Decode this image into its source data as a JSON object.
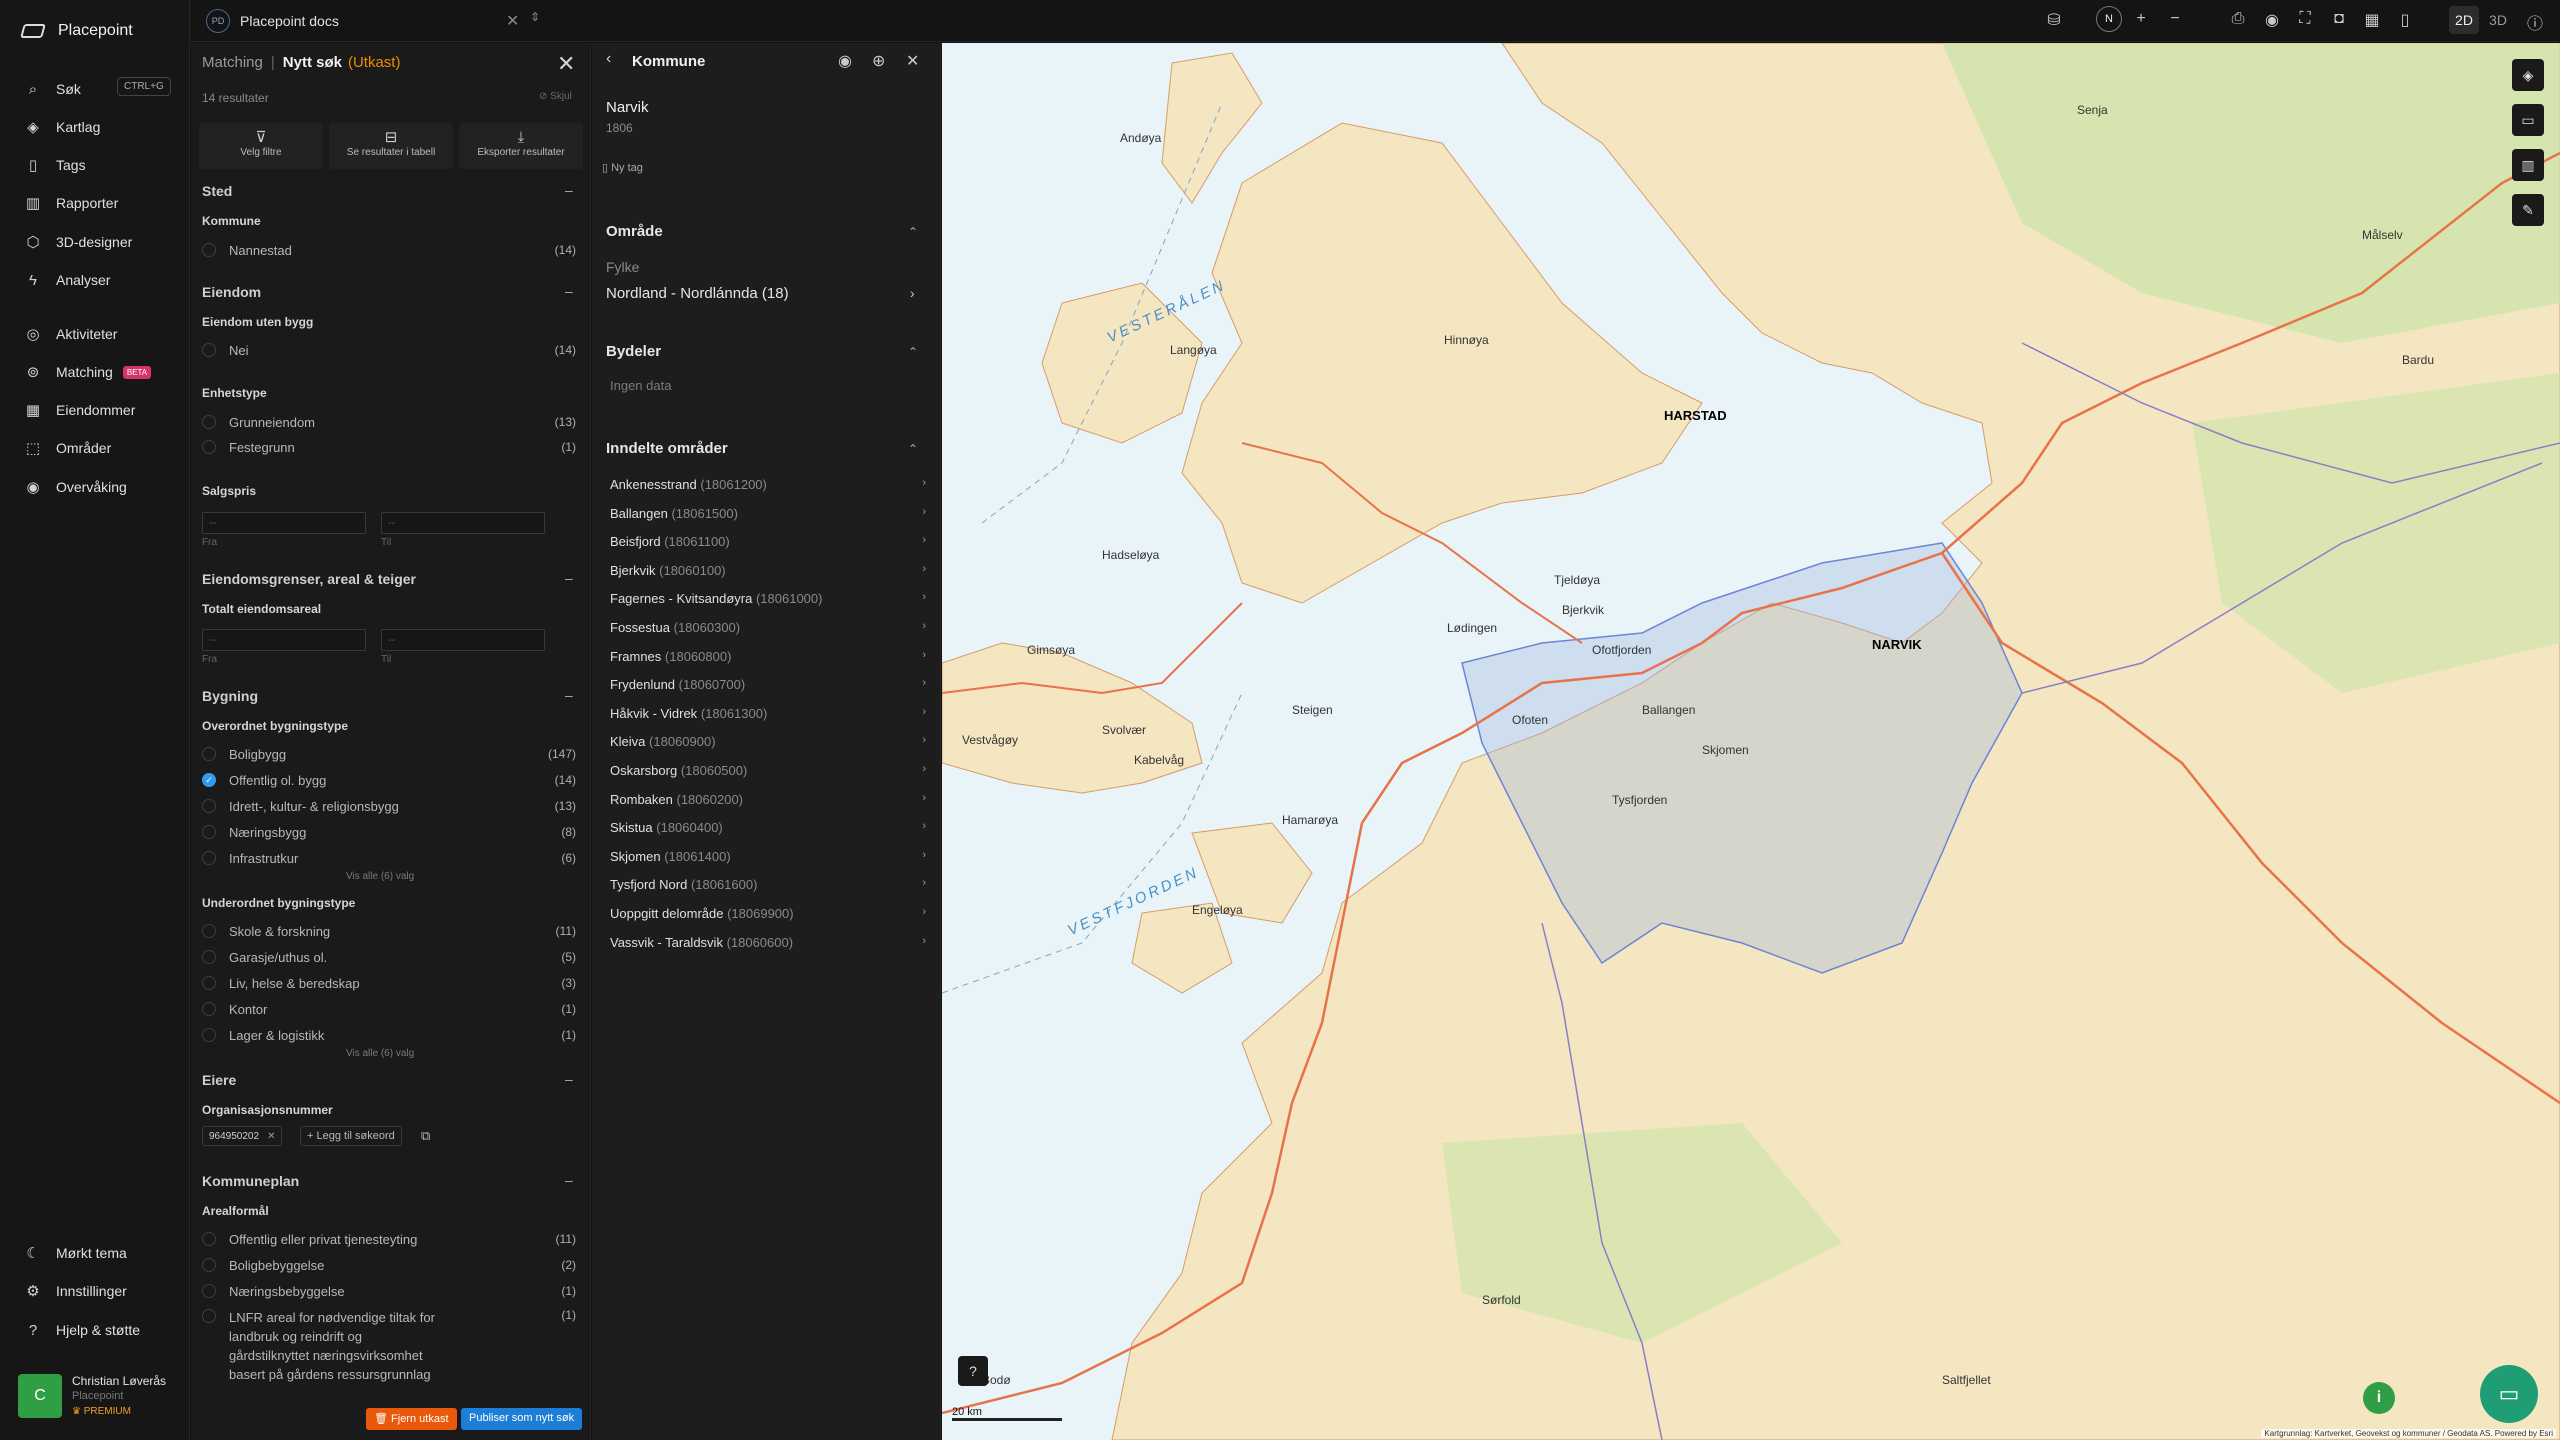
{
  "app": {
    "brand": "Placepoint"
  },
  "topbar": {
    "doc_badge": "PD",
    "doc_title": "Placepoint docs",
    "north": "N",
    "mode_2d": "2D",
    "mode_3d": "3D"
  },
  "nav": {
    "shortcut": "CTRL+G",
    "beta": "BETA",
    "items": [
      {
        "label": "Søk",
        "icon": "search-icon"
      },
      {
        "label": "Kartlag",
        "icon": "layers-icon"
      },
      {
        "label": "Tags",
        "icon": "bookmark-icon"
      },
      {
        "label": "Rapporter",
        "icon": "chart-icon"
      },
      {
        "label": "3D-designer",
        "icon": "cube-icon"
      },
      {
        "label": "Analyser",
        "icon": "bolt-icon"
      },
      {
        "label": "Aktiviteter",
        "icon": "activity-icon"
      },
      {
        "label": "Matching",
        "icon": "matching-icon"
      },
      {
        "label": "Eiendommer",
        "icon": "grid-icon"
      },
      {
        "label": "Områder",
        "icon": "area-icon"
      },
      {
        "label": "Overvåking",
        "icon": "monitor-icon"
      }
    ],
    "bottom": [
      {
        "label": "Mørkt tema",
        "icon": "moon-icon"
      },
      {
        "label": "Innstillinger",
        "icon": "gear-icon"
      },
      {
        "label": "Hjelp & støtte",
        "icon": "help-icon"
      }
    ],
    "user": {
      "initial": "C",
      "name": "Christian Løverås",
      "org": "Placepoint",
      "plan": "PREMIUM"
    }
  },
  "search": {
    "header_left": "Matching",
    "header_title": "Nytt søk",
    "header_status": "(Utkast)",
    "result_count": "14 resultater",
    "hide": "Skjul",
    "actions": [
      "Velg filtre",
      "Se resultater i tabell",
      "Eksporter resultater"
    ],
    "sections": {
      "sted": "Sted",
      "eiendom": "Eiendom",
      "grenser": "Eiendomsgrenser, areal & teiger",
      "bygning": "Bygning",
      "eiere": "Eiere",
      "kommuneplan": "Kommuneplan"
    },
    "kommune_label": "Kommune",
    "kommune_opts": [
      {
        "label": "Nannestad",
        "count": "(14)"
      }
    ],
    "uten_bygg_label": "Eiendom uten bygg",
    "uten_bygg_opts": [
      {
        "label": "Nei",
        "count": "(14)"
      }
    ],
    "enhetstype_label": "Enhetstype",
    "enhetstype_opts": [
      {
        "label": "Grunneiendom",
        "count": "(13)"
      },
      {
        "label": "Festegrunn",
        "count": "(1)"
      }
    ],
    "salgspris_label": "Salgspris",
    "areal_label": "Totalt eiendomsareal",
    "range_placeholder": "--",
    "range_from": "Fra",
    "range_to": "Til",
    "overordnet_label": "Overordnet bygningstype",
    "overordnet_opts": [
      {
        "label": "Boligbygg",
        "count": "(147)",
        "checked": false
      },
      {
        "label": "Offentlig ol. bygg",
        "count": "(14)",
        "checked": true
      },
      {
        "label": "Idrett-, kultur- & religionsbygg",
        "count": "(13)",
        "checked": false
      },
      {
        "label": "Næringsbygg",
        "count": "(8)",
        "checked": false
      },
      {
        "label": "Infrastrutkur",
        "count": "(6)",
        "checked": false
      }
    ],
    "show_all_1": "Vis alle (6) valg",
    "underordnet_label": "Underordnet bygningstype",
    "underordnet_opts": [
      {
        "label": "Skole & forskning",
        "count": "(11)"
      },
      {
        "label": "Garasje/uthus ol.",
        "count": "(5)"
      },
      {
        "label": "Liv, helse & beredskap",
        "count": "(3)"
      },
      {
        "label": "Kontor",
        "count": "(1)"
      },
      {
        "label": "Lager & logistikk",
        "count": "(1)"
      }
    ],
    "show_all_2": "Vis alle (6) valg",
    "org_label": "Organisasjonsnummer",
    "org_chip": "964950202",
    "add_keyword": "Legg til søkeord",
    "arealformal_label": "Arealformål",
    "arealformal_opts": [
      {
        "label": "Offentlig eller privat tjenesteyting",
        "count": "(11)"
      },
      {
        "label": "Boligbebyggelse",
        "count": "(2)"
      },
      {
        "label": "Næringsbebyggelse",
        "count": "(1)"
      }
    ],
    "lnfr": {
      "line1": "LNFR areal for nødvendige tiltak for",
      "line2": "landbruk og reindrift og",
      "line3": "gårdstilknyttet næringsvirksomhet",
      "line4": "basert på gårdens ressursgrunnlag",
      "count": "(1)"
    },
    "btn_remove": "Fjern utkast",
    "btn_publish": "Publiser som nytt søk"
  },
  "kommune": {
    "title": "Kommune",
    "name": "Narvik",
    "code": "1806",
    "tag": "Ny tag",
    "omrade": "Område",
    "fylke_label": "Fylke",
    "fylke_value": "Nordland - Nordlánnda (18)",
    "bydeler": "Bydeler",
    "bydeler_empty": "Ingen data",
    "inndelte": "Inndelte områder",
    "areas": [
      {
        "name": "Ankenesstrand",
        "code": "(18061200)"
      },
      {
        "name": "Ballangen",
        "code": "(18061500)"
      },
      {
        "name": "Beisfjord",
        "code": "(18061100)"
      },
      {
        "name": "Bjerkvik",
        "code": "(18060100)"
      },
      {
        "name": "Fagernes - Kvitsandøyra",
        "code": "(18061000)"
      },
      {
        "name": "Fossestua",
        "code": "(18060300)"
      },
      {
        "name": "Framnes",
        "code": "(18060800)"
      },
      {
        "name": "Frydenlund",
        "code": "(18060700)"
      },
      {
        "name": "Håkvik - Vidrek",
        "code": "(18061300)"
      },
      {
        "name": "Kleiva",
        "code": "(18060900)"
      },
      {
        "name": "Oskarsborg",
        "code": "(18060500)"
      },
      {
        "name": "Rombaken",
        "code": "(18060200)"
      },
      {
        "name": "Skistua",
        "code": "(18060400)"
      },
      {
        "name": "Skjomen",
        "code": "(18061400)"
      },
      {
        "name": "Tysfjord Nord",
        "code": "(18061600)"
      },
      {
        "name": "Uoppgitt delområde",
        "code": "(18069900)"
      },
      {
        "name": "Vassvik - Taraldsvik",
        "code": "(18060600)"
      }
    ]
  },
  "map": {
    "labels": [
      {
        "text": "Andøya",
        "cls": ""
      },
      {
        "text": "Langøya",
        "cls": ""
      },
      {
        "text": "Hinnøya",
        "cls": ""
      },
      {
        "text": "HARSTAD",
        "cls": "city"
      },
      {
        "text": "NARVIK",
        "cls": "city"
      },
      {
        "text": "Ofoten",
        "cls": ""
      },
      {
        "text": "Ofotfjorden",
        "cls": ""
      },
      {
        "text": "Senja",
        "cls": ""
      },
      {
        "text": "Målselv",
        "cls": ""
      },
      {
        "text": "Bardu",
        "cls": ""
      },
      {
        "text": "Hamarøya",
        "cls": ""
      },
      {
        "text": "Engeløya",
        "cls": ""
      },
      {
        "text": "Svolvær",
        "cls": ""
      },
      {
        "text": "Kabelvåg",
        "cls": ""
      },
      {
        "text": "Vestvågøy",
        "cls": ""
      },
      {
        "text": "Gimsøya",
        "cls": ""
      },
      {
        "text": "Hadseløya",
        "cls": ""
      },
      {
        "text": "Sørfold",
        "cls": ""
      },
      {
        "text": "Saltfjellet",
        "cls": ""
      },
      {
        "text": "Lødingen",
        "cls": ""
      },
      {
        "text": "Tjeldøya",
        "cls": ""
      },
      {
        "text": "Ballangen",
        "cls": ""
      },
      {
        "text": "Bjerkvik",
        "cls": ""
      },
      {
        "text": "Tysfjorden",
        "cls": ""
      },
      {
        "text": "Steigen",
        "cls": ""
      },
      {
        "text": "VESTERÅLEN",
        "cls": "sea"
      },
      {
        "text": "VESTFJORDEN",
        "cls": "sea"
      },
      {
        "text": "Skjomen",
        "cls": ""
      },
      {
        "text": "Bodø",
        "cls": ""
      }
    ],
    "scale": "20 km",
    "attribution": "Kartgrunnlag: Kartverket, Geovekst og kommuner / Geodata AS. Powered by Esri",
    "tools": [
      "layers-icon",
      "ruler-icon",
      "chart-icon",
      "draw-icon"
    ],
    "help": "?",
    "info": "i",
    "colors": {
      "land": "#f4e6c0",
      "sea": "#e8f4f8",
      "forest": "#c9e4a8",
      "road": "#e8724a",
      "boundary": "#8a7ec8"
    }
  }
}
